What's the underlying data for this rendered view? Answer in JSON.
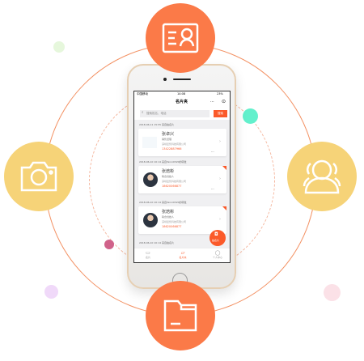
{
  "colors": {
    "accent": "#fb7a48",
    "yellow": "#f6d378"
  },
  "feature_icons": [
    "business-card-icon",
    "camera-icon",
    "contacts-icon",
    "folder-icon"
  ],
  "status_bar": {
    "carrier": "中国移动",
    "time": "14:08",
    "battery": "23%"
  },
  "nav": {
    "title": "名片夹"
  },
  "search": {
    "placeholder": "搜索姓名、电话",
    "button": "搜索"
  },
  "groups": [
    {
      "header": "2018-06-11 15:55 来自拍名片",
      "card": {
        "name": "张卓兴",
        "title": "销售经理",
        "company": "深圳爱售科技有限公司",
        "phone": "13422887966"
      }
    },
    {
      "header": "2018-06-10 10:14 来自Yanni0320的转发",
      "card": {
        "name": "张焙彬",
        "title": "联合创始人",
        "company": "深圳爱售科技有限公司",
        "phone": "18620066877"
      }
    },
    {
      "header": "2018-06-10 10:14 来自Yanni0320的转发",
      "card": {
        "name": "张焙彬",
        "title": "联合创始人",
        "company": "深圳爱售科技有限公司",
        "phone": "18620066877"
      }
    },
    {
      "header": "2018-06-10 10:14 来自拍名片"
    }
  ],
  "fab": {
    "label": "拍名片"
  },
  "tabs": [
    {
      "label": "名片"
    },
    {
      "label": "名片夹",
      "active": true
    },
    {
      "label": "个人中心"
    }
  ]
}
